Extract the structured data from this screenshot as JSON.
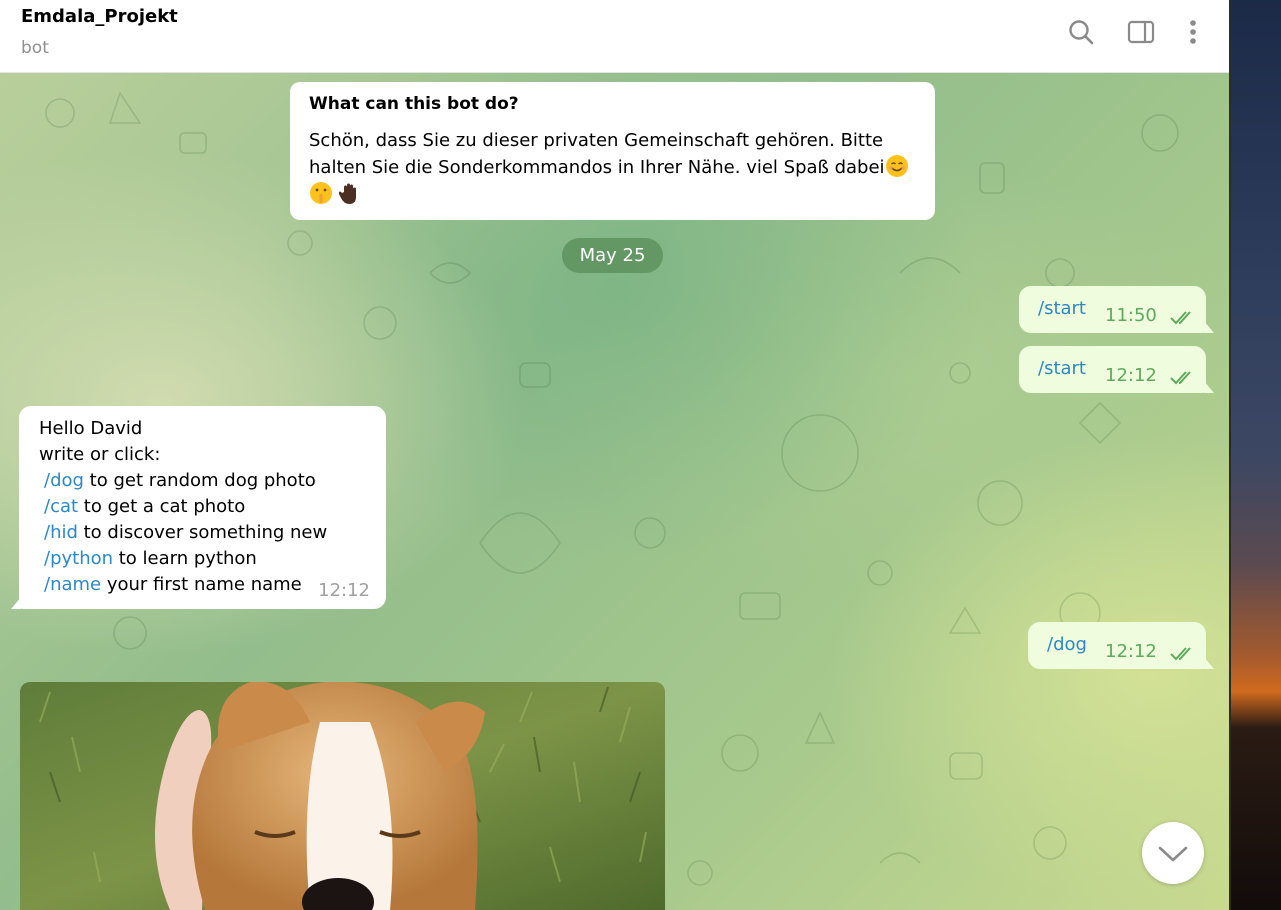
{
  "header": {
    "title": "Emdala_Projekt",
    "subtitle": "bot",
    "icons": [
      "search-icon",
      "sidebar-toggle-icon",
      "more-vertical-icon"
    ]
  },
  "bot_info": {
    "title": "What can this bot do?",
    "text": "Schön, dass Sie zu dieser privaten Gemeinschaft gehören. Bitte halten Sie die Sonderkommandos in Ihrer Nähe. viel Spaß dabei",
    "emojis": [
      "smiling-face-emoji",
      "shushing-face-emoji",
      "raised-hand-emoji"
    ]
  },
  "date_separator": "May 25",
  "messages": [
    {
      "direction": "out",
      "text": "/start",
      "time": "11:50",
      "status": "read"
    },
    {
      "direction": "out",
      "text": "/start",
      "time": "12:12",
      "status": "read"
    },
    {
      "direction": "in",
      "time": "12:12",
      "lines": [
        {
          "text": "Hello David"
        },
        {
          "text": "write or click:"
        },
        {
          "cmd": "/dog",
          "text": " to get random dog photo"
        },
        {
          "cmd": "/cat",
          "text": " to get a cat photo"
        },
        {
          "cmd": "/hid",
          "text": " to discover something new"
        },
        {
          "cmd": "/python",
          "text": " to learn python"
        },
        {
          "cmd": "/name",
          "text": " your first name name"
        }
      ]
    },
    {
      "direction": "out",
      "text": "/dog",
      "time": "12:12",
      "status": "read"
    },
    {
      "direction": "in",
      "type": "photo",
      "subject": "corgi puppy being petted on grass"
    }
  ],
  "colors": {
    "outgoing_bubble": "#effdde",
    "incoming_bubble": "#ffffff",
    "link": "#2d88c8",
    "time_out": "#5fa95c",
    "date_pill": "#6a9a66"
  }
}
